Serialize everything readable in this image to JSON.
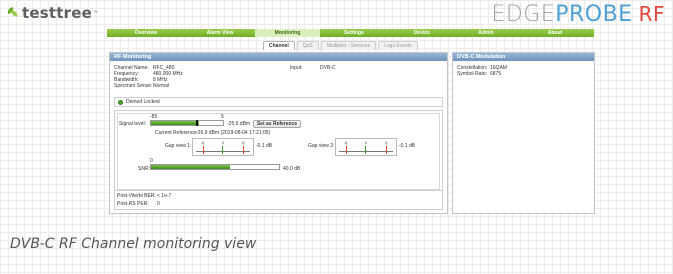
{
  "header": {
    "logo_text": "testtree",
    "logo_tm": "™",
    "brand_part1": "EDGE",
    "brand_part2": "PROBE",
    "brand_part3": "RF"
  },
  "nav": {
    "items": [
      "Overview",
      "Alarm View",
      "Monitoring",
      "Settings",
      "Device",
      "Admin",
      "About"
    ],
    "active": "Monitoring"
  },
  "subtabs": {
    "items": [
      "Channel",
      "QoS",
      "Multiplex - Services",
      "Logs Events"
    ],
    "active": "Channel"
  },
  "rf": {
    "title": "RF Monitoring",
    "channel_name_label": "Channel Name:",
    "channel_name": "RFC_480",
    "frequency_label": "Frequency:",
    "frequency": "480.000 MHz",
    "bandwidth_label": "Bandwidth:",
    "bandwidth": "8 MHz",
    "spectrum_label": "Spectrum Sense:",
    "spectrum": "Normal",
    "input_label": "Input:",
    "input": "DVB-C",
    "demod_status": "Demod Locked",
    "signal_label": "Signal level:",
    "signal_min": "-85",
    "signal_max": "5",
    "signal_value": "-25.6 dBm",
    "signal_fraction": 0.66,
    "reference_fraction": 0.62,
    "set_reference": "Set as Reference",
    "current_ref_label": "Current Reference:",
    "current_ref": "-26.9 dBm (2019-08-04 17:21:05)",
    "gap1_label": "Gap view 1:",
    "gap1_value": "-0.1 dB",
    "gap2_label": "Gap view 2:",
    "gap2_value": "-0.1 dB",
    "gap_ticks": [
      "-6",
      "0",
      "6"
    ],
    "snr_label": "SNR:",
    "snr_min": "0",
    "snr_value": "40.0 dB",
    "snr_fraction": 0.62,
    "post_viterbi_label": "Post-Viterbi BER:",
    "post_viterbi": "< 1e-7",
    "post_rs_label": "Post-RS PER:",
    "post_rs": "0"
  },
  "dvbc": {
    "title": "DVB-C Modulation",
    "constellation_label": "Constellation:",
    "constellation": "16QAM",
    "symbol_rate_label": "Symbol Rate:",
    "symbol_rate": "6875"
  },
  "caption": "DVB-C RF Channel monitoring view",
  "colors": {
    "nav_green": "#7ab833",
    "panel_blue": "#7d9fc6",
    "brand_blue": "#4e9fd6",
    "brand_red": "#e2463c",
    "gap_red": "#e0442e",
    "gap_green": "#3a9a25"
  }
}
